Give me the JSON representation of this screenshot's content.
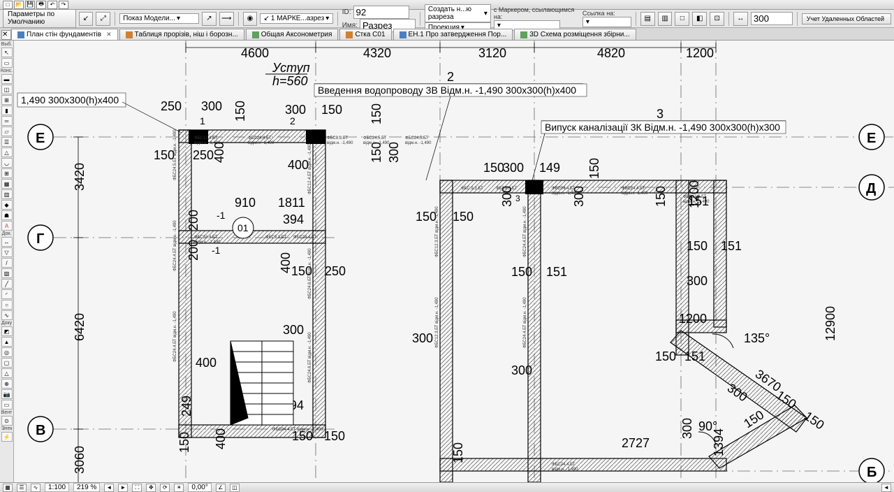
{
  "toolbar1": {
    "params_label": "Параметры по Умолчанию"
  },
  "toolbar2": {
    "model_display": "Показ Модели...",
    "marker_view": "1 МАРКЕ...азрез",
    "id_label": "ID:",
    "id_value": "92",
    "name_label": "Имя:",
    "name_value": "Разрез",
    "with_marker": "с Маркером, ссылающимся на:",
    "link_label": "Ссылка на:",
    "create_dropdown": "Создать н...ю разреза",
    "projection_dropdown": "Проекция",
    "dist_value": "300",
    "deleted_label": "Учет Удаленных Областей"
  },
  "tabs": {
    "t1": "План стін фундаментів",
    "t2": "Таблиця прорізів, ніш і борозн...",
    "t3": "Общая Аксонометрия",
    "t4": "Стка С01",
    "t5": "ЕН.1 Про затвердження Пор...",
    "t6": "3D Схема розміщення збірни..."
  },
  "status": {
    "scale": "1:100",
    "zoom": "219 %",
    "angle": "0,00°"
  },
  "dims": {
    "d4600": "4600",
    "d4320": "4320",
    "d3120": "3120",
    "d4820": "4820",
    "d1200": "1200",
    "d250": "250",
    "d300": "300",
    "d150": "150",
    "d400": "400",
    "d200": "200",
    "d151": "151",
    "d910": "910",
    "d1811": "1811",
    "d394": "394",
    "d249": "249",
    "d149": "149",
    "d2727": "2727",
    "d3420": "3420",
    "d6420": "6420",
    "d3060": "3060",
    "d12900": "12900",
    "d1394": "1394",
    "d3670": "3670",
    "d135": "135°",
    "d90": "90°"
  },
  "texts": {
    "ustup": "Уступ",
    "h560": "h=560",
    "box_left": "1,490 300x300(h)x400",
    "box_water": "Введення водопроводу 3В Відм.н. -1,490 300х300(h)х400",
    "box_sewer": "Випуск каналізації 3К Відм.н. -1,490 300х300(h)х300",
    "n2": "2",
    "n3": "3",
    "n1": "1",
    "nm1": "-1",
    "n01": "01"
  },
  "grid": {
    "E": "Е",
    "G": "Г",
    "V": "В",
    "D": "Д",
    "B": "Б"
  }
}
